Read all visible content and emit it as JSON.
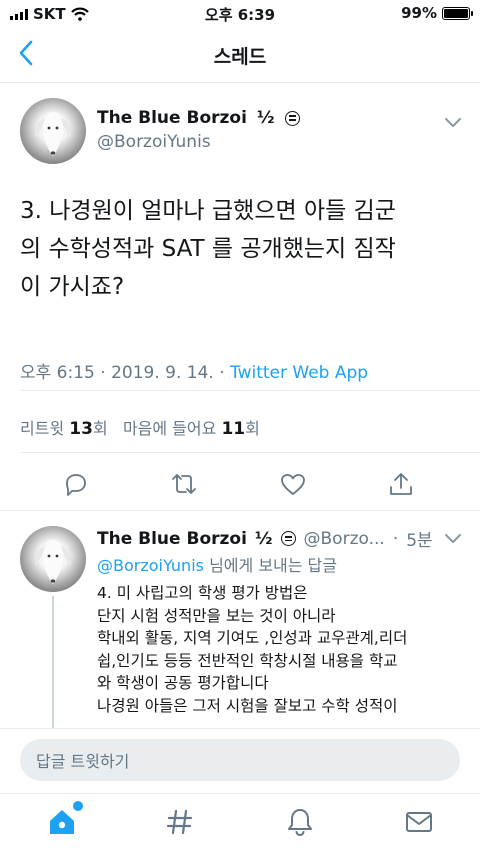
{
  "status": {
    "carrier": "SKT",
    "time": "오후 6:39",
    "battery": "99%",
    "battery_level": 0.99
  },
  "nav": {
    "title": "스레드"
  },
  "tweet": {
    "name": "The Blue Borzoi",
    "badge": "½",
    "handle": "@BorzoiYunis",
    "text": "3. 나경원이 얼마나 급했으면 아들 김군\n의 수학성적과 SAT 를 공개했는지 짐작\n이 가시죠?",
    "timestamp": "오후 6:15 · 2019. 9. 14. · ",
    "source": "Twitter Web App",
    "retweets_label": "리트윗",
    "retweets": "13",
    "retweets_unit": "회",
    "likes_label": "마음에 들어요",
    "likes": "11",
    "likes_unit": "회"
  },
  "reply": {
    "name": "The Blue Borzoi",
    "badge": "½",
    "handle": "@Borzo...",
    "dot": "·",
    "time": "5분",
    "replying_to_mention": "@BorzoiYunis",
    "replying_to_suffix": " 님에게 보내는 답글",
    "text": "4. 미 사립고의 학생 평가 방법은\n단지 시험 성적만을 보는 것이 아니라\n학내외 활동, 지역 기여도 ,인성과 교우관계,리더\n쉽,인기도 등등 전반적인 학창시절 내용을 학교\n와 학생이 공동 평가합니다\n나경원 아들은 그저 시험을 잘보고 수학 성적이"
  },
  "composer": {
    "placeholder": "답글 트윗하기"
  },
  "colors": {
    "accent": "#1da1f2",
    "secondary": "#657786"
  }
}
